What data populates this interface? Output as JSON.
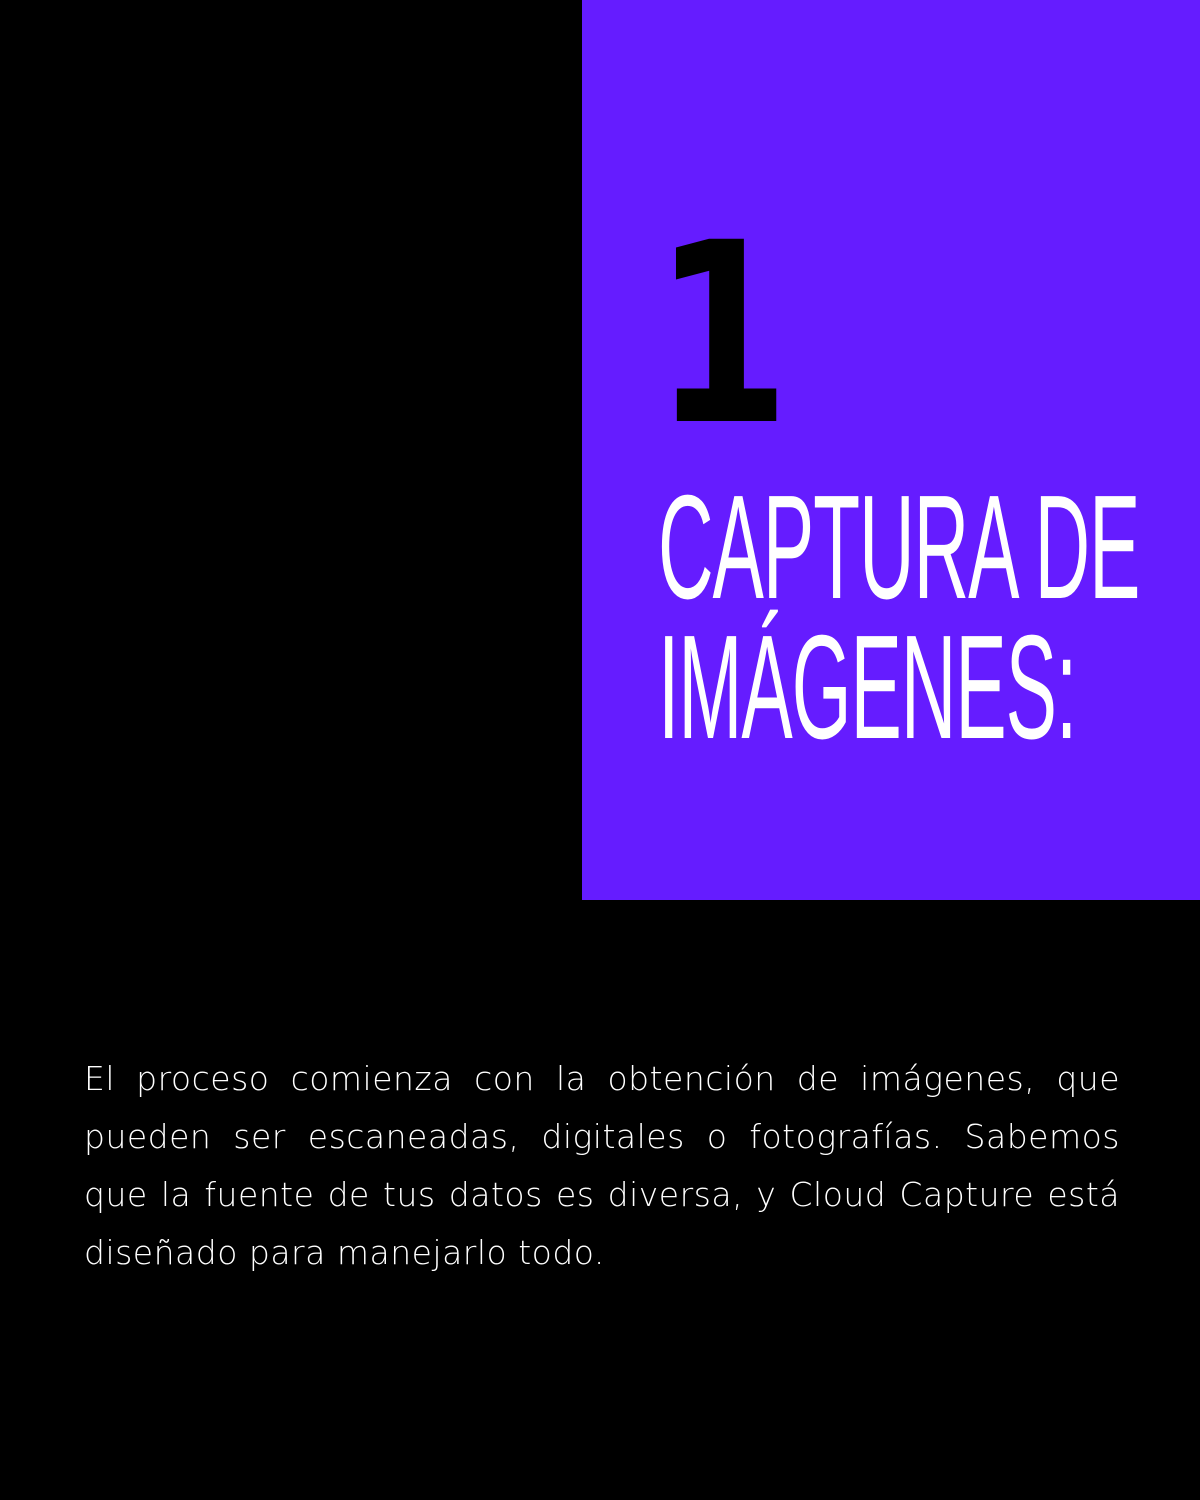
{
  "panel": {
    "number": "1",
    "title_line1": "CAPTURA DE",
    "title_line2": "IMÁGENES:",
    "color": "#651cff"
  },
  "body": {
    "text": "El proceso comienza con la obtención de imágenes, que pueden ser escaneadas, digitales o fotografías. Sabemos que la fuente de tus datos es diversa, y Cloud Capture está diseñado para manejarlo todo."
  },
  "colors": {
    "background": "#000000",
    "text": "#ffffff"
  }
}
